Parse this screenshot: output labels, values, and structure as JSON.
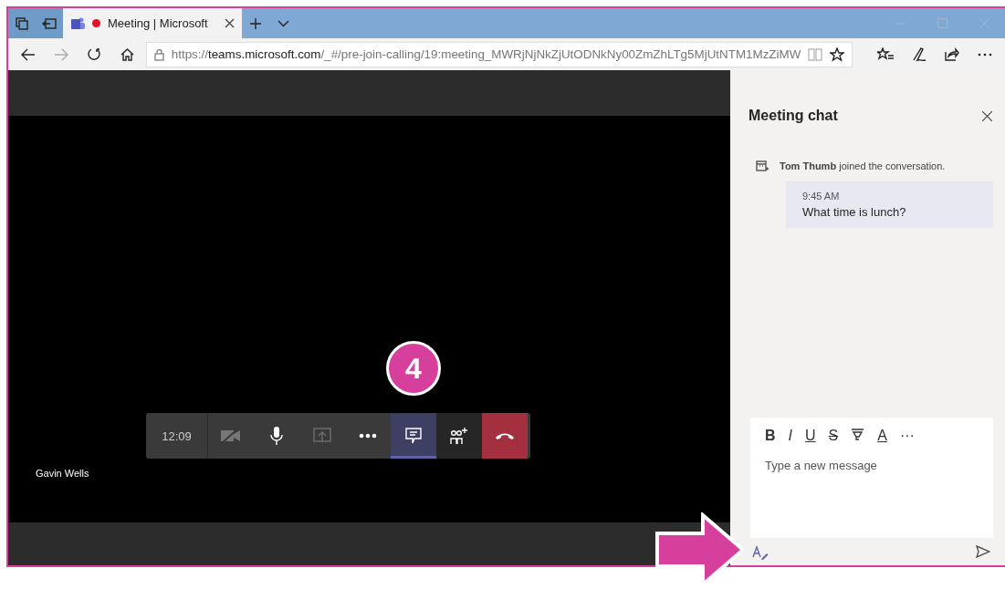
{
  "browser": {
    "tab": {
      "title": "Meeting | Microsoft",
      "recording": true
    },
    "url": {
      "prefix": "https://",
      "host": "teams.microsoft.com",
      "path": "/_#/pre-join-calling/19:meeting_MWRjNjNkZjUtODNkNy00ZmZhLTg5MjUtNTM1MzZiMW"
    }
  },
  "callout": {
    "number": "4"
  },
  "meeting": {
    "timer": "12:09",
    "participant": "Gavin Wells",
    "controls": [
      {
        "kind": "camera",
        "selected": false,
        "disabled": false
      },
      {
        "kind": "mic",
        "selected": false,
        "disabled": false
      },
      {
        "kind": "share",
        "selected": false,
        "disabled": true
      },
      {
        "kind": "more",
        "selected": false,
        "disabled": false
      },
      {
        "kind": "chat",
        "selected": true,
        "disabled": false
      },
      {
        "kind": "people",
        "selected": false,
        "disabled": false
      },
      {
        "kind": "hangup",
        "selected": false,
        "disabled": false
      }
    ]
  },
  "chat": {
    "title": "Meeting chat",
    "event": {
      "name": "Tom Thumb",
      "text": "joined the conversation."
    },
    "messages": [
      {
        "time": "9:45 AM",
        "text": "What time is lunch?"
      }
    ],
    "format": [
      {
        "kind": "bold",
        "label": "B"
      },
      {
        "kind": "italic",
        "label": "I"
      },
      {
        "kind": "underline",
        "label": "U"
      },
      {
        "kind": "strike",
        "label": "S"
      },
      {
        "kind": "highlight"
      },
      {
        "kind": "color",
        "label": "A"
      },
      {
        "kind": "more",
        "label": "···"
      }
    ],
    "compose": {
      "placeholder": "Type a new message"
    }
  }
}
